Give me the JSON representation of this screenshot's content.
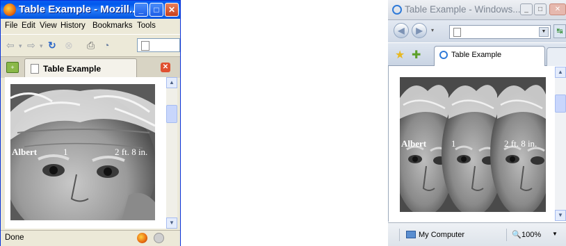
{
  "firefox": {
    "title": "Table Example - Mozill...",
    "menu": [
      "File",
      "Edit",
      "View",
      "History",
      "Bookmarks",
      "Tools"
    ],
    "tab_label": "Table Example",
    "status": "Done",
    "cells": [
      "Albert",
      "1",
      "2 ft. 8 in."
    ]
  },
  "ie": {
    "title": "Table Example - Windows...",
    "tab_label": "Table Example",
    "zone": "My Computer",
    "zoom": "100%",
    "cells": [
      "Albert",
      "1",
      "2 ft. 8 in."
    ]
  },
  "icons": {
    "firefox": [
      "firefox-logo-icon",
      "minimize-icon",
      "maximize-icon",
      "close-icon",
      "back-icon",
      "forward-icon",
      "reload-icon",
      "stop-icon",
      "print-icon",
      "history-icon",
      "document-icon",
      "new-tab-icon",
      "tab-close-icon",
      "scroll-up-icon",
      "scroll-down-icon",
      "firebug-icon",
      "security-icon"
    ],
    "ie": [
      "ie-logo-icon",
      "back-icon",
      "forward-icon",
      "document-icon",
      "dropdown-icon",
      "refresh-icon",
      "favorites-star-icon",
      "add-favorites-icon",
      "computer-icon",
      "zoom-icon"
    ]
  }
}
